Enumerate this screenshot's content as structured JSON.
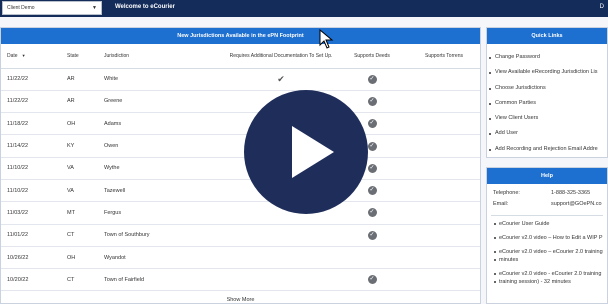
{
  "header": {
    "client_select_value": "Client Demo",
    "welcome": "Welcome to eCourier",
    "right_text": "D"
  },
  "panel": {
    "title": "New Jurisdictions Available in the ePN Footprint",
    "columns": {
      "date": "Date",
      "state": "State",
      "jurisdiction": "Jurisdiction",
      "requires": "Requires Additional Documentation To Set Up.",
      "deeds": "Supports Deeds",
      "torrens": "Supports Torrens"
    },
    "rows": [
      {
        "date": "11/22/22",
        "state": "AR",
        "jurisdiction": "White",
        "requires": true,
        "deeds": true
      },
      {
        "date": "11/22/22",
        "state": "AR",
        "jurisdiction": "Greene",
        "requires": false,
        "deeds": true
      },
      {
        "date": "11/18/22",
        "state": "OH",
        "jurisdiction": "Adams",
        "requires": false,
        "deeds": true
      },
      {
        "date": "11/14/22",
        "state": "KY",
        "jurisdiction": "Owen",
        "requires": false,
        "deeds": true
      },
      {
        "date": "11/10/22",
        "state": "VA",
        "jurisdiction": "Wythe",
        "requires": false,
        "deeds": true
      },
      {
        "date": "11/10/22",
        "state": "VA",
        "jurisdiction": "Tazewell",
        "requires": false,
        "deeds": true
      },
      {
        "date": "11/03/22",
        "state": "MT",
        "jurisdiction": "Fergus",
        "requires": false,
        "deeds": true
      },
      {
        "date": "11/01/22",
        "state": "CT",
        "jurisdiction": "Town of Southbury",
        "requires": false,
        "deeds": true
      },
      {
        "date": "10/26/22",
        "state": "OH",
        "jurisdiction": "Wyandot",
        "requires": false,
        "deeds": false
      },
      {
        "date": "10/20/22",
        "state": "CT",
        "jurisdiction": "Town of Fairfield",
        "requires": false,
        "deeds": true
      }
    ],
    "show_more": "Show More"
  },
  "quick_links": {
    "title": "Quick Links",
    "items": [
      "Change Password",
      "View Available eRecording Jurisdiction Lis",
      "Choose Jurisdictions",
      "Common Parties",
      "View Client Users",
      "Add User",
      "Add Recording and Rejection Email Addre"
    ]
  },
  "help": {
    "title": "Help",
    "telephone_label": "Telephone:",
    "telephone_value": "1-888-325-3365",
    "email_label": "Email:",
    "email_value": "support@GOePN.co",
    "links": [
      "eCourier User Guide",
      "eCourier v2.0 video – How to Edit a WIP P",
      "eCourier v2.0 video – eCourier 2.0 training",
      "minutes",
      "eCourier v2.0 video - eCourier 2.0 training",
      "training session) - 32 minutes"
    ]
  },
  "colors": {
    "topbar": "#142c5a",
    "panel_header": "#1d6fd0",
    "play_button": "#1f2d5a"
  },
  "icons": {
    "check": "check-circle-icon",
    "play": "play-icon",
    "cursor": "mouse-cursor-icon",
    "sort": "sort-down-icon",
    "dropdown": "chevron-down-icon"
  }
}
